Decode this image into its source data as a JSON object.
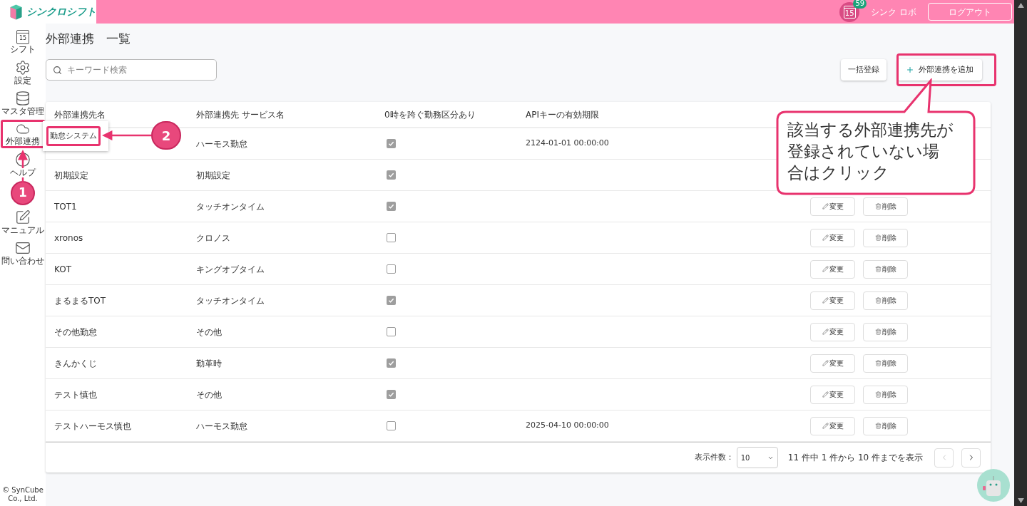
{
  "header": {
    "logo_text": "シンクロシフト",
    "calendar_day": "15",
    "badge": "59",
    "user": "シンク ロボ",
    "logout": "ログアウト"
  },
  "sidebar": {
    "items": [
      {
        "kind": "calendar",
        "label": "シフト",
        "icon_text": "15",
        "highlighted": false
      },
      {
        "kind": "settings",
        "label": "設定",
        "highlighted": false
      },
      {
        "kind": "database",
        "label": "マスタ管理",
        "highlighted": false
      },
      {
        "kind": "cloud",
        "label": "外部連携",
        "highlighted": true
      },
      {
        "kind": "help",
        "label": "ヘルプ",
        "highlighted": false
      },
      {
        "kind": "manual",
        "label": "マニュアル",
        "highlighted": false
      },
      {
        "kind": "mail",
        "label": "問い合わせ",
        "highlighted": false
      }
    ],
    "copyright": "© SynCube Co., Ltd."
  },
  "page_title": "外部連携　一覧",
  "search": {
    "placeholder": "キーワード検索"
  },
  "actions": {
    "bulk": "一括登録",
    "add": "外部連携を追加"
  },
  "table": {
    "columns": [
      "外部連携先名",
      "外部連携先 サービス名",
      "0時を跨ぐ勤務区分あり",
      "APIキーの有効期限"
    ],
    "rows": [
      {
        "service": "ハーモス勤怠",
        "checked": true,
        "expiry": "2124-01-01 00:00:00"
      },
      {
        "name": "初期設定",
        "service": "初期設定",
        "checked": true
      },
      {
        "name": "TOT1",
        "service": "タッチオンタイム",
        "checked": true,
        "edit": "変更",
        "delete": "削除"
      },
      {
        "name": "xronos",
        "service": "クロノス",
        "checked": false,
        "edit": "変更",
        "delete": "削除"
      },
      {
        "name": "KOT",
        "service": "キングオブタイム",
        "checked": false,
        "edit": "変更",
        "delete": "削除"
      },
      {
        "name": "まるまるTOT",
        "service": "タッチオンタイム",
        "checked": true,
        "edit": "変更",
        "delete": "削除"
      },
      {
        "name": "その他勤怠",
        "service": "その他",
        "checked": false,
        "edit": "変更",
        "delete": "削除"
      },
      {
        "name": "きんかくじ",
        "service": "勤革時",
        "checked": true,
        "edit": "変更",
        "delete": "削除"
      },
      {
        "name": "テスト慎也",
        "service": "その他",
        "checked": true,
        "edit": "変更",
        "delete": "削除"
      },
      {
        "name": "テストハーモス慎也",
        "service": "ハーモス勤怠",
        "checked": false,
        "expiry": "2025-04-10 00:00:00",
        "edit": "変更",
        "delete": "削除"
      }
    ]
  },
  "pagination": {
    "per_page_label": "表示件数：",
    "per_page": "10",
    "summary": "11 件中 1 件から 10 件までを表示",
    "prev_disabled": true,
    "next_disabled": false
  },
  "tooltip": {
    "text": "勤怠システム"
  },
  "annotations": {
    "callout": "該当する外部連携先が登録されていない場合はクリック",
    "steps": [
      "1",
      "2"
    ]
  }
}
